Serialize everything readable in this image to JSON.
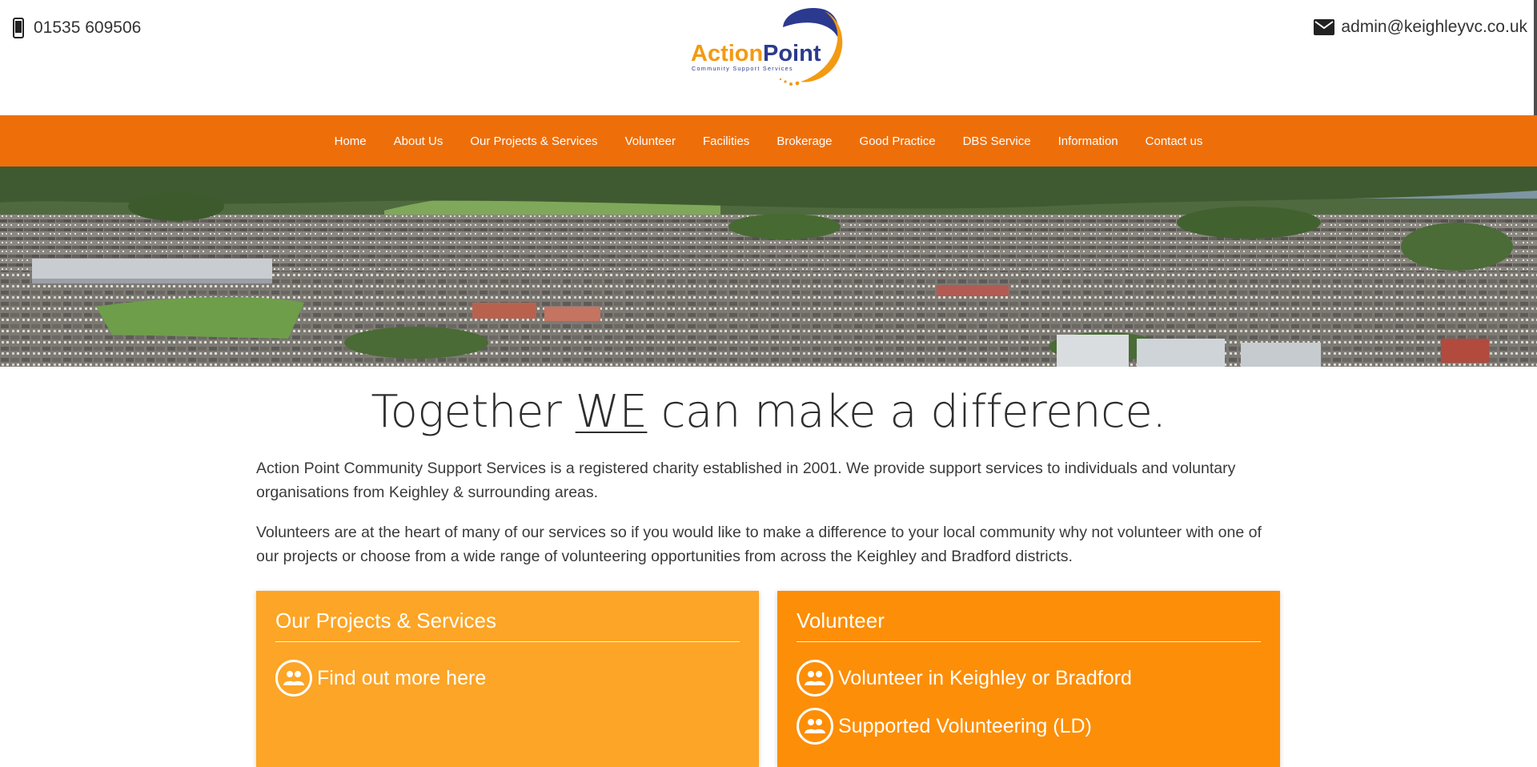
{
  "header": {
    "phone": "01535 609506",
    "email": "admin@keighleyvc.co.uk",
    "logo": {
      "line1_word1": "Action",
      "line1_word2": "Point",
      "tagline": "Community Support Services"
    }
  },
  "nav": {
    "items": [
      {
        "label": "Home"
      },
      {
        "label": "About Us"
      },
      {
        "label": "Our Projects & Services"
      },
      {
        "label": "Volunteer"
      },
      {
        "label": "Facilities"
      },
      {
        "label": "Brokerage"
      },
      {
        "label": "Good Practice"
      },
      {
        "label": "DBS Service"
      },
      {
        "label": "Information"
      },
      {
        "label": "Contact us"
      }
    ]
  },
  "main": {
    "headline_pre": "Together ",
    "headline_em": "WE",
    "headline_post": " can make a difference.",
    "paragraph1": "Action Point Community Support Services is a registered charity established in 2001. We provide support services to individuals and voluntary organisations from Keighley & surrounding areas.",
    "paragraph2": "Volunteers are at the heart of many of our services so if you would like to make a difference to your local community why not volunteer with one of our projects or choose from a wide range of volunteering opportunities from across the Keighley and Bradford districts."
  },
  "cards": [
    {
      "title": "Our Projects & Services",
      "items": [
        {
          "label": "Find out more here",
          "icon": "people-icon"
        }
      ]
    },
    {
      "title": "Volunteer",
      "items": [
        {
          "label": "Volunteer in Keighley or Bradford",
          "icon": "people-icon"
        },
        {
          "label": "Supported Volunteering (LD)",
          "icon": "people-icon"
        }
      ]
    }
  ],
  "colors": {
    "nav_bg": "#ee6f0a",
    "card_left_bg": "#fca526",
    "card_right_bg": "#fd8e07",
    "logo_blue": "#2b3a8f",
    "logo_orange": "#f39a12"
  }
}
